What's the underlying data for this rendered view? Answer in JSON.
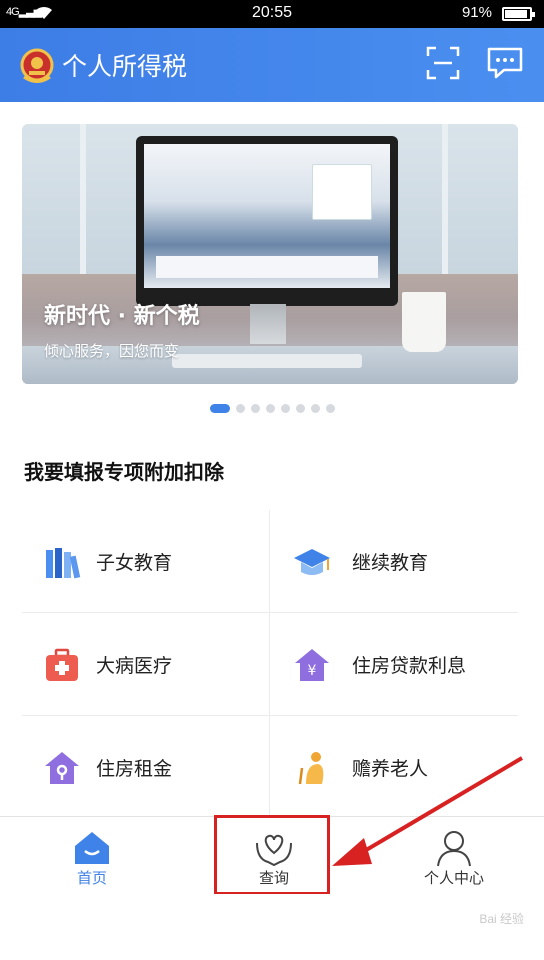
{
  "status_bar": {
    "signal": "4G",
    "time": "20:55",
    "battery": "91%",
    "battery_level": 0.91
  },
  "header": {
    "title": "个人所得税"
  },
  "banner": {
    "title": "新时代 · 新个税",
    "subtitle": "倾心服务，因您而变",
    "page_count": 8,
    "active_page": 1
  },
  "section": {
    "title": "我要填报专项附加扣除"
  },
  "deductions": [
    {
      "label": "子女教育",
      "icon": "books-icon"
    },
    {
      "label": "继续教育",
      "icon": "graduation-cap-icon"
    },
    {
      "label": "大病医疗",
      "icon": "medical-kit-icon"
    },
    {
      "label": "住房贷款利息",
      "icon": "house-yuan-icon"
    },
    {
      "label": "住房租金",
      "icon": "house-key-icon"
    },
    {
      "label": "赡养老人",
      "icon": "elderly-icon"
    }
  ],
  "tabbar": {
    "tabs": [
      {
        "label": "首页",
        "icon": "home-icon",
        "active": true
      },
      {
        "label": "查询",
        "icon": "heart-hands-icon",
        "active": false
      },
      {
        "label": "个人中心",
        "icon": "person-icon",
        "active": false
      }
    ]
  },
  "colors": {
    "primary": "#3f82e8",
    "highlight": "#d82222"
  },
  "watermark": "Bai 经验"
}
